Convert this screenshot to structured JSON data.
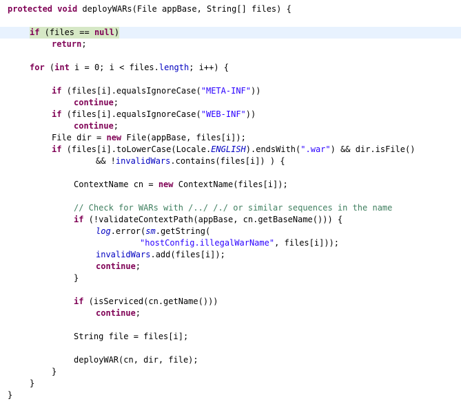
{
  "editor": {
    "language": "java",
    "highlighted_line": 2,
    "colors": {
      "keyword": "#7f0055",
      "string": "#2a00ff",
      "field": "#0000c0",
      "comment": "#3f7f5f",
      "plain": "#000000",
      "current_line": "#e8f2fe"
    },
    "lines": [
      {
        "indent": 0,
        "tokens": [
          {
            "t": "kw",
            "v": "protected"
          },
          {
            "t": "p",
            "v": " "
          },
          {
            "t": "kw",
            "v": "void"
          },
          {
            "t": "p",
            "v": " deployWARs(File appBase, String[] files) {"
          }
        ]
      },
      {
        "indent": 0,
        "tokens": []
      },
      {
        "indent": 1,
        "tokens": [
          {
            "t": "kw",
            "v": "if"
          },
          {
            "t": "p",
            "v": " (files == "
          },
          {
            "t": "kw",
            "v": "null"
          },
          {
            "t": "p",
            "v": ")"
          }
        ]
      },
      {
        "indent": 2,
        "tokens": [
          {
            "t": "kw",
            "v": "return"
          },
          {
            "t": "p",
            "v": ";"
          }
        ]
      },
      {
        "indent": 0,
        "tokens": []
      },
      {
        "indent": 1,
        "tokens": [
          {
            "t": "kw",
            "v": "for"
          },
          {
            "t": "p",
            "v": " ("
          },
          {
            "t": "kw",
            "v": "int"
          },
          {
            "t": "p",
            "v": " i = 0; i < files."
          },
          {
            "t": "fld",
            "v": "length"
          },
          {
            "t": "p",
            "v": "; i++) {"
          }
        ]
      },
      {
        "indent": 0,
        "tokens": []
      },
      {
        "indent": 2,
        "tokens": [
          {
            "t": "kw",
            "v": "if"
          },
          {
            "t": "p",
            "v": " (files[i].equalsIgnoreCase("
          },
          {
            "t": "str",
            "v": "\"META-INF\""
          },
          {
            "t": "p",
            "v": "))"
          }
        ]
      },
      {
        "indent": 3,
        "tokens": [
          {
            "t": "kw",
            "v": "continue"
          },
          {
            "t": "p",
            "v": ";"
          }
        ]
      },
      {
        "indent": 2,
        "tokens": [
          {
            "t": "kw",
            "v": "if"
          },
          {
            "t": "p",
            "v": " (files[i].equalsIgnoreCase("
          },
          {
            "t": "str",
            "v": "\"WEB-INF\""
          },
          {
            "t": "p",
            "v": "))"
          }
        ]
      },
      {
        "indent": 3,
        "tokens": [
          {
            "t": "kw",
            "v": "continue"
          },
          {
            "t": "p",
            "v": ";"
          }
        ]
      },
      {
        "indent": 2,
        "tokens": [
          {
            "t": "p",
            "v": "File dir = "
          },
          {
            "t": "kw",
            "v": "new"
          },
          {
            "t": "p",
            "v": " File(appBase, files[i]);"
          }
        ]
      },
      {
        "indent": 2,
        "tokens": [
          {
            "t": "kw",
            "v": "if"
          },
          {
            "t": "p",
            "v": " (files[i].toLowerCase(Locale."
          },
          {
            "t": "sfld",
            "v": "ENGLISH"
          },
          {
            "t": "p",
            "v": ").endsWith("
          },
          {
            "t": "str",
            "v": "\".war\""
          },
          {
            "t": "p",
            "v": ") && dir.isFile()"
          }
        ]
      },
      {
        "indent": 4,
        "tokens": [
          {
            "t": "p",
            "v": "&& !"
          },
          {
            "t": "fld",
            "v": "invalidWars"
          },
          {
            "t": "p",
            "v": ".contains(files[i]) ) {"
          }
        ]
      },
      {
        "indent": 0,
        "tokens": []
      },
      {
        "indent": 3,
        "tokens": [
          {
            "t": "p",
            "v": "ContextName cn = "
          },
          {
            "t": "kw",
            "v": "new"
          },
          {
            "t": "p",
            "v": " ContextName(files[i]);"
          }
        ]
      },
      {
        "indent": 0,
        "tokens": []
      },
      {
        "indent": 3,
        "tokens": [
          {
            "t": "cmt",
            "v": "// Check for WARs with /../ /./ or similar sequences in the name"
          }
        ]
      },
      {
        "indent": 3,
        "tokens": [
          {
            "t": "kw",
            "v": "if"
          },
          {
            "t": "p",
            "v": " (!validateContextPath(appBase, cn.getBaseName())) {"
          }
        ]
      },
      {
        "indent": 4,
        "tokens": [
          {
            "t": "sfld",
            "v": "log"
          },
          {
            "t": "p",
            "v": ".error("
          },
          {
            "t": "sfld",
            "v": "sm"
          },
          {
            "t": "p",
            "v": ".getString("
          }
        ]
      },
      {
        "indent": 6,
        "tokens": [
          {
            "t": "str",
            "v": "\"hostConfig.illegalWarName\""
          },
          {
            "t": "p",
            "v": ", files[i]));"
          }
        ]
      },
      {
        "indent": 4,
        "tokens": [
          {
            "t": "fld",
            "v": "invalidWars"
          },
          {
            "t": "p",
            "v": ".add(files[i]);"
          }
        ]
      },
      {
        "indent": 4,
        "tokens": [
          {
            "t": "kw",
            "v": "continue"
          },
          {
            "t": "p",
            "v": ";"
          }
        ]
      },
      {
        "indent": 3,
        "tokens": [
          {
            "t": "p",
            "v": "}"
          }
        ]
      },
      {
        "indent": 0,
        "tokens": []
      },
      {
        "indent": 3,
        "tokens": [
          {
            "t": "kw",
            "v": "if"
          },
          {
            "t": "p",
            "v": " (isServiced(cn.getName()))"
          }
        ]
      },
      {
        "indent": 4,
        "tokens": [
          {
            "t": "kw",
            "v": "continue"
          },
          {
            "t": "p",
            "v": ";"
          }
        ]
      },
      {
        "indent": 0,
        "tokens": []
      },
      {
        "indent": 3,
        "tokens": [
          {
            "t": "p",
            "v": "String file = files[i];"
          }
        ]
      },
      {
        "indent": 0,
        "tokens": []
      },
      {
        "indent": 3,
        "tokens": [
          {
            "t": "p",
            "v": "deployWAR(cn, dir, file);"
          }
        ]
      },
      {
        "indent": 2,
        "tokens": [
          {
            "t": "p",
            "v": "}"
          }
        ]
      },
      {
        "indent": 1,
        "tokens": [
          {
            "t": "p",
            "v": "}"
          }
        ]
      },
      {
        "indent": 0,
        "tokens": [
          {
            "t": "p",
            "v": "}"
          }
        ]
      }
    ]
  }
}
